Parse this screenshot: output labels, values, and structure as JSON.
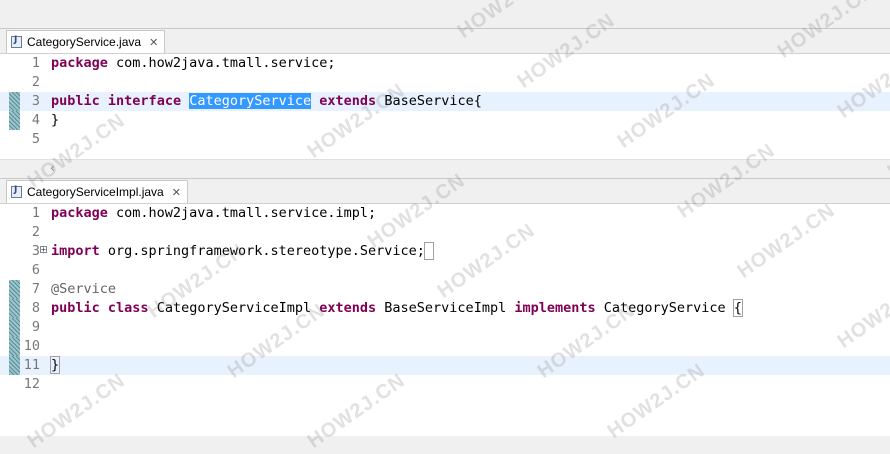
{
  "editors": [
    {
      "tab_label": "CategoryService.java",
      "lines": [
        {
          "num": "1",
          "tokens": [
            {
              "t": "package",
              "c": "kw"
            },
            {
              "t": " com.how2java.tmall.service;"
            }
          ]
        },
        {
          "num": "2",
          "tokens": []
        },
        {
          "num": "3",
          "mark": true,
          "current": true,
          "tokens": [
            {
              "t": "public",
              "c": "kw"
            },
            {
              "t": " "
            },
            {
              "t": "interface",
              "c": "kw"
            },
            {
              "t": " "
            },
            {
              "t": "CategoryService",
              "c": "sel"
            },
            {
              "t": " "
            },
            {
              "t": "extends",
              "c": "kw"
            },
            {
              "t": " BaseService{"
            }
          ]
        },
        {
          "num": "4",
          "mark": true,
          "tokens": [
            {
              "t": "}"
            }
          ]
        },
        {
          "num": "5",
          "tokens": []
        }
      ]
    },
    {
      "tab_label": "CategoryServiceImpl.java",
      "lines": [
        {
          "num": "1",
          "tokens": [
            {
              "t": "package",
              "c": "kw"
            },
            {
              "t": " com.how2java.tmall.service.impl;"
            }
          ]
        },
        {
          "num": "2",
          "tokens": []
        },
        {
          "num": "3",
          "fold": true,
          "tokens": [
            {
              "t": "import",
              "c": "kw"
            },
            {
              "t": " org.springframework.stereotype.Service;"
            },
            {
              "t": " ",
              "c": "bracket"
            }
          ]
        },
        {
          "num": "6",
          "tokens": []
        },
        {
          "num": "7",
          "mark": true,
          "tokens": [
            {
              "t": "@Service",
              "c": "ann"
            }
          ]
        },
        {
          "num": "8",
          "mark": true,
          "tokens": [
            {
              "t": "public",
              "c": "kw"
            },
            {
              "t": " "
            },
            {
              "t": "class",
              "c": "kw"
            },
            {
              "t": " CategoryServiceImpl "
            },
            {
              "t": "extends",
              "c": "kw"
            },
            {
              "t": " BaseServiceImpl "
            },
            {
              "t": "implements",
              "c": "kw"
            },
            {
              "t": " CategoryService "
            },
            {
              "t": "{",
              "c": "bracket"
            }
          ]
        },
        {
          "num": "9",
          "mark": true,
          "tokens": []
        },
        {
          "num": "10",
          "mark": true,
          "tokens": []
        },
        {
          "num": "11",
          "mark": true,
          "current": true,
          "caret": true,
          "tokens": [
            {
              "t": "}",
              "c": "bracket"
            }
          ]
        },
        {
          "num": "12",
          "tokens": []
        }
      ]
    }
  ],
  "watermark": "HOW2J.CN",
  "icons": {
    "file": "java-file-icon",
    "close": "close-tab-icon",
    "scroll": "chevron-left-icon"
  }
}
